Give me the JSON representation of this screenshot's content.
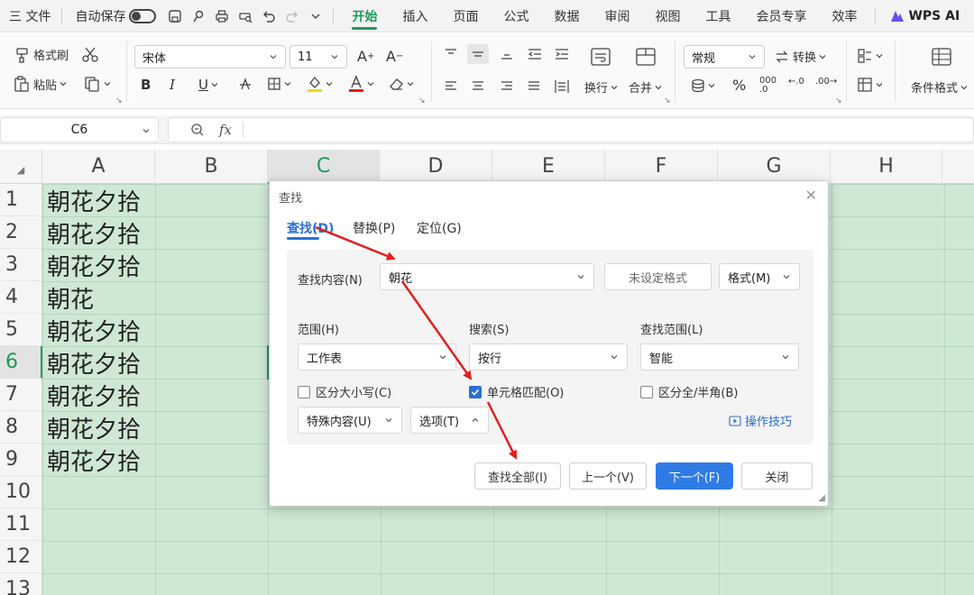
{
  "menubar": {
    "file_menu": "三 文件",
    "autosave": "自动保存",
    "tabs": [
      "开始",
      "插入",
      "页面",
      "公式",
      "数据",
      "审阅",
      "视图",
      "工具",
      "会员专享",
      "效率"
    ],
    "active_tab": "开始",
    "wps_ai": "WPS AI",
    "accent_color": "#1d9b5a"
  },
  "ribbon": {
    "format_painter": "格式刷",
    "paste": "粘贴",
    "font_name": "宋体",
    "font_size": "11",
    "wrap_text": "换行",
    "merge": "合并",
    "number_format": "常规",
    "convert": "转换",
    "conditional_format": "条件格式",
    "bold": "B",
    "italic": "I",
    "underline": "U",
    "percent": "%"
  },
  "formula_bar": {
    "name_box": "C6",
    "fx": "fx"
  },
  "sheet": {
    "columns": [
      "A",
      "B",
      "C",
      "D",
      "E",
      "F",
      "G",
      "H"
    ],
    "selected_column": "C",
    "rows": [
      "1",
      "2",
      "3",
      "4",
      "5",
      "6",
      "7",
      "8",
      "9",
      "10",
      "11",
      "12",
      "13"
    ],
    "selected_row": "6",
    "column_a_values": [
      "朝花夕拾",
      "朝花夕拾",
      "朝花夕拾",
      "朝花",
      "朝花夕拾",
      "朝花夕拾",
      "朝花夕拾",
      "朝花夕拾",
      "朝花夕拾"
    ],
    "fill_color": "#cfe8d4"
  },
  "dialog": {
    "title": "查找",
    "tabs": {
      "find": "查找(D)",
      "replace": "替换(P)",
      "goto": "定位(G)"
    },
    "find_label": "查找内容(N)",
    "find_value": "朝花",
    "no_format": "未设定格式",
    "format_btn": "格式(M)",
    "scope_label": "范围(H)",
    "scope_value": "工作表",
    "search_label": "搜索(S)",
    "search_value": "按行",
    "lookin_label": "查找范围(L)",
    "lookin_value": "智能",
    "match_case": "区分大小写(C)",
    "match_case_checked": false,
    "whole_cell": "单元格匹配(O)",
    "whole_cell_checked": true,
    "full_half": "区分全/半角(B)",
    "full_half_checked": false,
    "special": "特殊内容(U)",
    "options": "选项(T)",
    "tips": "操作技巧",
    "find_all": "查找全部(I)",
    "prev": "上一个(V)",
    "next": "下一个(F)",
    "close": "关闭",
    "primary_color": "#2f7be5",
    "arrow_color": "#e02020"
  }
}
